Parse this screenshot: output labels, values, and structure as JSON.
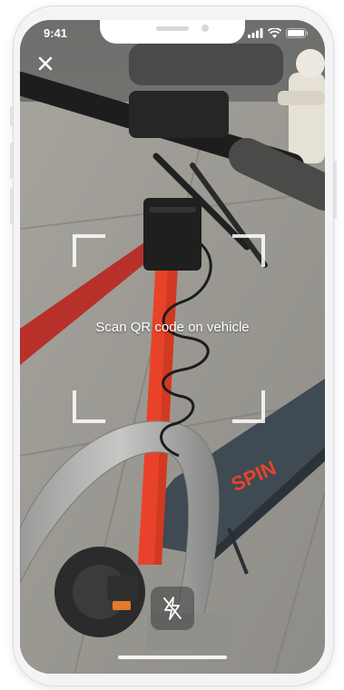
{
  "status_bar": {
    "time": "9:41",
    "icons": [
      "signal-icon",
      "wifi-icon",
      "battery-icon"
    ]
  },
  "scanner": {
    "close_icon": "close-icon",
    "instruction": "Scan QR code on vehicle",
    "flash_icon": "flash-off-icon"
  },
  "scene": {
    "deck_brand": "SPIN",
    "scooter_color": "#e8432a",
    "deck_color": "#3f4a52"
  }
}
